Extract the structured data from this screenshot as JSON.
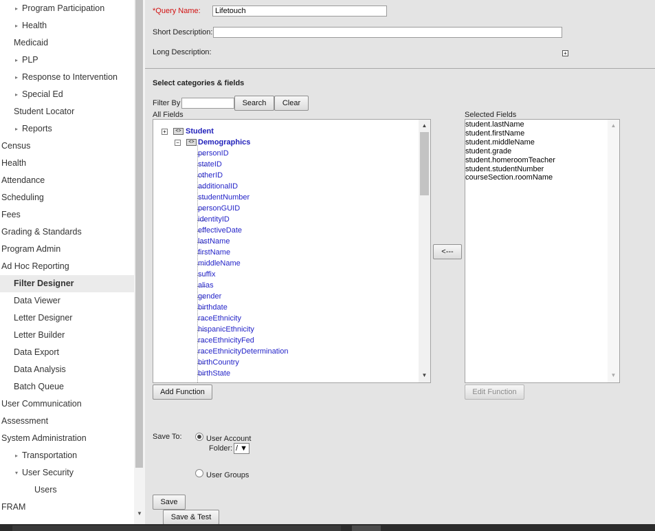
{
  "sidebar": {
    "items": [
      {
        "label": "Program Participation",
        "indent": 2,
        "caret": "right"
      },
      {
        "label": "Health",
        "indent": 2,
        "caret": "right"
      },
      {
        "label": "Medicaid",
        "indent": 1,
        "caret": "none"
      },
      {
        "label": "PLP",
        "indent": 2,
        "caret": "right"
      },
      {
        "label": "Response to Intervention",
        "indent": 2,
        "caret": "right"
      },
      {
        "label": "Special Ed",
        "indent": 2,
        "caret": "right"
      },
      {
        "label": "Student Locator",
        "indent": 1,
        "caret": "none"
      },
      {
        "label": "Reports",
        "indent": 2,
        "caret": "right"
      },
      {
        "label": "Census",
        "indent": 0,
        "caret": "none"
      },
      {
        "label": "Health",
        "indent": 0,
        "caret": "none"
      },
      {
        "label": "Attendance",
        "indent": 0,
        "caret": "none"
      },
      {
        "label": "Scheduling",
        "indent": 0,
        "caret": "none"
      },
      {
        "label": "Fees",
        "indent": 0,
        "caret": "none"
      },
      {
        "label": "Grading & Standards",
        "indent": 0,
        "caret": "none"
      },
      {
        "label": "Program Admin",
        "indent": 0,
        "caret": "none"
      },
      {
        "label": "Ad Hoc Reporting",
        "indent": 0,
        "caret": "none"
      },
      {
        "label": "Filter Designer",
        "indent": 1,
        "caret": "none",
        "active": true
      },
      {
        "label": "Data Viewer",
        "indent": 1,
        "caret": "none"
      },
      {
        "label": "Letter Designer",
        "indent": 1,
        "caret": "none"
      },
      {
        "label": "Letter Builder",
        "indent": 1,
        "caret": "none"
      },
      {
        "label": "Data Export",
        "indent": 1,
        "caret": "none"
      },
      {
        "label": "Data Analysis",
        "indent": 1,
        "caret": "none"
      },
      {
        "label": "Batch Queue",
        "indent": 1,
        "caret": "none"
      },
      {
        "label": "User Communication",
        "indent": 0,
        "caret": "none"
      },
      {
        "label": "Assessment",
        "indent": 0,
        "caret": "none"
      },
      {
        "label": "System Administration",
        "indent": 0,
        "caret": "none"
      },
      {
        "label": "Transportation",
        "indent": 2,
        "caret": "right"
      },
      {
        "label": "User Security",
        "indent": 2,
        "caret": "down"
      },
      {
        "label": "Users",
        "indent": 3,
        "caret": "none"
      },
      {
        "label": "FRAM",
        "indent": 0,
        "caret": "none"
      }
    ]
  },
  "form": {
    "query_name_required": "*",
    "query_name_label": "Query Name:",
    "query_name_value": "Lifetouch",
    "short_desc_label": "Short Description:",
    "short_desc_value": "",
    "long_desc_label": "Long Description:",
    "section_title": "Select categories & fields",
    "filter_by_label": "Filter By",
    "filter_value": "",
    "search_button": "Search",
    "clear_button": "Clear",
    "all_fields_label": "All Fields",
    "selected_fields_label": "Selected Fields",
    "move_left_button": "<---",
    "add_function_button": "Add Function",
    "edit_function_button": "Edit Function",
    "save_to_label": "Save To:",
    "user_account_label": "User Account",
    "folder_label": "Folder:",
    "folder_value": "/",
    "user_groups_label": "User Groups",
    "save_button": "Save",
    "save_test_button": "Save & Test"
  },
  "tree": {
    "root": "Student",
    "category": "Demographics",
    "fields": [
      "personID",
      "stateID",
      "otherID",
      "additionalID",
      "studentNumber",
      "personGUID",
      "identityID",
      "effectiveDate",
      "lastName",
      "firstName",
      "middleName",
      "suffix",
      "alias",
      "gender",
      "birthdate",
      "raceEthnicity",
      "hispanicEthnicity",
      "raceEthnicityFed",
      "raceEthnicityDetermination",
      "birthCountry",
      "birthState"
    ]
  },
  "selected_fields": [
    "student.lastName",
    "student.firstName",
    "student.middleName",
    "student.grade",
    "student.homeroomTeacher",
    "student.studentNumber",
    "courseSection.roomName"
  ],
  "icons": {
    "caret_right": "▸",
    "caret_down": "▾",
    "plus": "+",
    "minus": "−",
    "scroll_up": "▲",
    "scroll_down": "▼",
    "select_arrow": "▼"
  }
}
